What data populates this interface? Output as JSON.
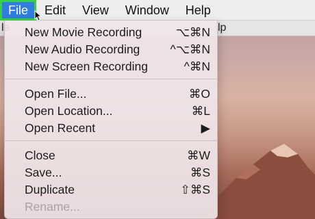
{
  "menubar": {
    "items": [
      "File",
      "Edit",
      "View",
      "Window",
      "Help"
    ]
  },
  "background_window": {
    "left_fragment": "la",
    "right_fragment": "lp"
  },
  "file_menu": {
    "groups": [
      [
        {
          "label": "New Movie Recording",
          "shortcut": "⌥⌘N",
          "enabled": true
        },
        {
          "label": "New Audio Recording",
          "shortcut": "^⌥⌘N",
          "enabled": true
        },
        {
          "label": "New Screen Recording",
          "shortcut": "^⌘N",
          "enabled": true
        }
      ],
      [
        {
          "label": "Open File...",
          "shortcut": "⌘O",
          "enabled": true
        },
        {
          "label": "Open Location...",
          "shortcut": "⌘L",
          "enabled": true
        },
        {
          "label": "Open Recent",
          "shortcut": "▶",
          "enabled": true
        }
      ],
      [
        {
          "label": "Close",
          "shortcut": "⌘W",
          "enabled": true
        },
        {
          "label": "Save...",
          "shortcut": "⌘S",
          "enabled": true
        },
        {
          "label": "Duplicate",
          "shortcut": "⇧⌘S",
          "enabled": true
        },
        {
          "label": "Rename...",
          "shortcut": "",
          "enabled": false
        }
      ]
    ]
  },
  "colors": {
    "menu_highlight": "#2f7de1",
    "highlight_outline": "#37d33f"
  }
}
